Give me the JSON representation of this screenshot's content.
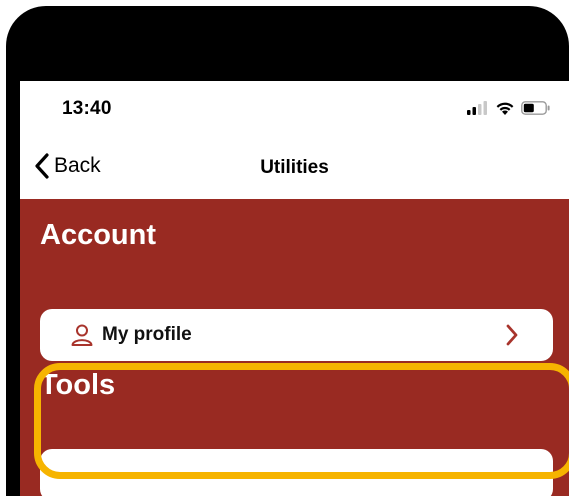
{
  "status_bar": {
    "time": "13:40",
    "signal_icon": "signal-bars-icon",
    "wifi_icon": "wifi-icon",
    "battery_icon": "battery-icon"
  },
  "nav": {
    "back_label": "Back",
    "back_icon": "chevron-left-icon",
    "title": "Utilities"
  },
  "sections": {
    "account": {
      "title": "Account",
      "items": [
        {
          "label": "My profile",
          "icon": "user-icon",
          "trailing_icon": "chevron-right-icon",
          "highlighted": true
        }
      ]
    },
    "tools": {
      "title": "Tools",
      "items": [
        {
          "label": "",
          "icon": "",
          "trailing_icon": ""
        }
      ]
    }
  },
  "colors": {
    "brand_red": "#992a22",
    "highlight": "#f6b400",
    "card_bg": "#ffffff",
    "frame": "#000000"
  }
}
